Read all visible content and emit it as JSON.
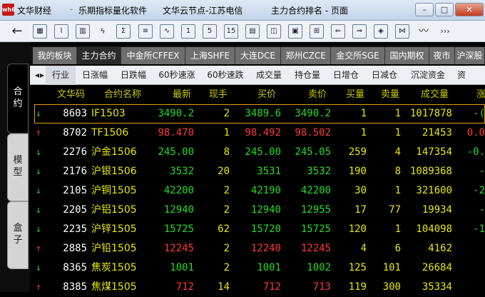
{
  "window": {
    "logo": "wh6",
    "app_name": "文华财经",
    "software": "乐期指标量化软件",
    "node": "文华云节点-江苏电信",
    "page_title": "主力合约排名 - 页面",
    "buttons": {
      "minimize": "–",
      "maximize": "□",
      "close": "✕"
    }
  },
  "toolbar": {
    "back": "←",
    "num_buttons": [
      "1",
      "5",
      "15"
    ],
    "more": "›››"
  },
  "side_tabs": [
    {
      "label": [
        "合",
        "约"
      ]
    },
    {
      "label": [
        "模",
        "型"
      ]
    },
    {
      "label": [
        "盒",
        "子"
      ]
    }
  ],
  "market_tabs": [
    "我的板块",
    "主力合约",
    "中金所CFFEX",
    "上海SHFE",
    "大连DCE",
    "郑州CZCE",
    "金交所SGE",
    "国内期权",
    "夜市",
    "沪深股"
  ],
  "active_market_tab": 1,
  "sort_tabs": [
    "◂",
    "▸",
    "行业",
    "日涨幅",
    "日跌幅",
    "60秒速涨",
    "60秒速跌",
    "成交量",
    "持仓量",
    "日增仓",
    "日减仓",
    "沉淀资金",
    "资"
  ],
  "columns": [
    "文华码",
    "合约名称",
    "最新",
    "现手",
    "买价",
    "卖价",
    "买量",
    "卖量",
    "成交量",
    "涨"
  ],
  "rows": [
    {
      "dir": "↓",
      "code": "8603",
      "name": "IF1503",
      "last": "3490.2",
      "lot": "2",
      "bid": "3489.6",
      "ask": "3490.2",
      "bidvol": "1",
      "askvol": "1",
      "volume": "1017878",
      "chg": "-(",
      "color": "#22dd22"
    },
    {
      "dir": "↑",
      "code": "8702",
      "name": "TF1506",
      "last": "98.470",
      "lot": "1",
      "bid": "98.492",
      "ask": "98.502",
      "bidvol": "1",
      "askvol": "1",
      "volume": "21453",
      "chg": "0.0",
      "color": "#ff3838"
    },
    {
      "dir": "↓",
      "code": "2276",
      "name": "沪金1506",
      "last": "245.00",
      "lot": "8",
      "bid": "245.00",
      "ask": "245.05",
      "bidvol": "259",
      "askvol": "4",
      "volume": "147354",
      "chg": "-0.",
      "color": "#22dd22"
    },
    {
      "dir": "↓",
      "code": "2176",
      "name": "沪银1506",
      "last": "3532",
      "lot": "20",
      "bid": "3531",
      "ask": "3532",
      "bidvol": "190",
      "askvol": "8",
      "volume": "1089368",
      "chg": "-",
      "color": "#22dd22"
    },
    {
      "dir": "↓",
      "code": "2105",
      "name": "沪铜1505",
      "last": "42200",
      "lot": "2",
      "bid": "42190",
      "ask": "42200",
      "bidvol": "30",
      "askvol": "1",
      "volume": "321600",
      "chg": "-2",
      "color": "#22dd22"
    },
    {
      "dir": "↓",
      "code": "2205",
      "name": "沪铝1505",
      "last": "12940",
      "lot": "2",
      "bid": "12940",
      "ask": "12955",
      "bidvol": "17",
      "askvol": "77",
      "volume": "19934",
      "chg": "-",
      "color": "#22dd22"
    },
    {
      "dir": "↓",
      "code": "2235",
      "name": "沪锌1505",
      "last": "15725",
      "lot": "62",
      "bid": "15720",
      "ask": "15725",
      "bidvol": "120",
      "askvol": "1",
      "volume": "104098",
      "chg": "-1",
      "color": "#22dd22"
    },
    {
      "dir": "↑",
      "code": "2885",
      "name": "沪铅1505",
      "last": "12245",
      "lot": "2",
      "bid": "12240",
      "ask": "12245",
      "bidvol": "4",
      "askvol": "6",
      "volume": "4162",
      "chg": "",
      "color": "#ff3838"
    },
    {
      "dir": "↓",
      "code": "8365",
      "name": "焦炭1505",
      "last": "1001",
      "lot": "2",
      "bid": "1001",
      "ask": "1002",
      "bidvol": "125",
      "askvol": "101",
      "volume": "26684",
      "chg": "",
      "color": "#22dd22"
    },
    {
      "dir": "↑",
      "code": "8385",
      "name": "焦煤1505",
      "last": "712",
      "lot": "14",
      "bid": "712",
      "ask": "713",
      "bidvol": "119",
      "askvol": "300",
      "volume": "35334",
      "chg": "",
      "color": "#ff3838"
    }
  ]
}
